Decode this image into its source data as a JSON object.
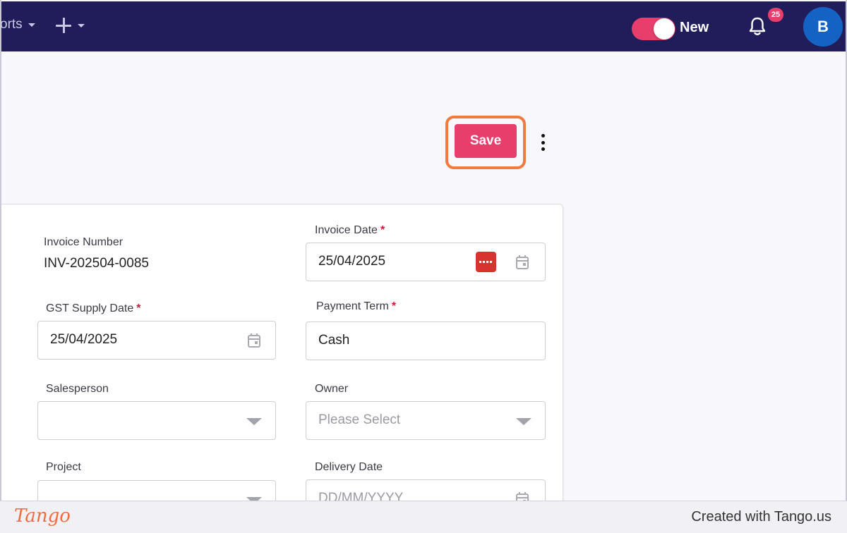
{
  "topbar": {
    "nav_reports_label": "orts",
    "toggle_label": "New",
    "toggle_on": true,
    "notification_count": "25",
    "avatar_initial": "B"
  },
  "toolbar": {
    "save_label": "Save"
  },
  "form": {
    "invoice_number": {
      "label": "Invoice Number",
      "value": "INV-202504-0085"
    },
    "invoice_date": {
      "label": "Invoice Date",
      "required": "*",
      "value": "25/04/2025"
    },
    "gst_supply_date": {
      "label": "GST Supply Date",
      "required": "*",
      "value": "25/04/2025"
    },
    "payment_term": {
      "label": "Payment Term",
      "required": "*",
      "value": "Cash"
    },
    "salesperson": {
      "label": "Salesperson",
      "value": ""
    },
    "owner": {
      "label": "Owner",
      "placeholder": "Please Select"
    },
    "project": {
      "label": "Project",
      "value": ""
    },
    "delivery_date": {
      "label": "Delivery Date",
      "placeholder": "DD/MM/YYYY"
    }
  },
  "footer": {
    "logo_text": "Tango",
    "credit_text": "Created with Tango.us"
  },
  "colors": {
    "topbar_bg": "#211d5a",
    "accent": "#e83e6c",
    "highlight": "#f07a3f",
    "avatar_bg": "#1362c4"
  }
}
